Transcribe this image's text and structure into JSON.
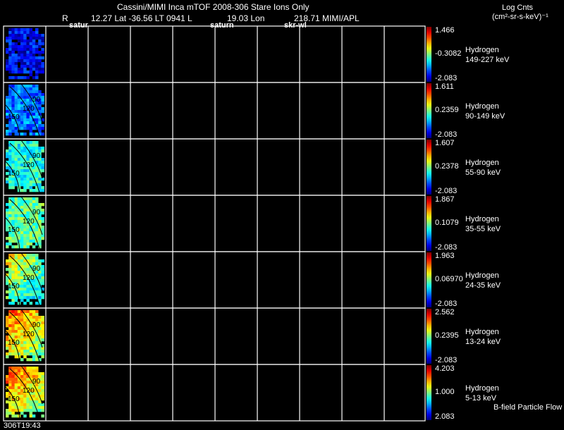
{
  "header": {
    "title": "Cassini/MIMI Inca mTOF  2008-306   Stare   Ions Only",
    "r_label": "R",
    "r_line": "12.27 Lat -36.56 LT 0941 L",
    "l_value": "19.03 Lon",
    "lon_value": "218.71  MIMI/APL",
    "marker_satur": "satur",
    "marker_saturn": "saturn",
    "marker_skr": "skr-wl"
  },
  "units": {
    "line1": "Log Cnts",
    "line2": "(cm²-sr-s-keV)⁻¹"
  },
  "footer": {
    "timestamp": "306T19:43",
    "legend_note": "B-field Particle Flow"
  },
  "contour_labels": [
    "90",
    "120",
    "150"
  ],
  "panels": [
    {
      "species": "Hydrogen",
      "energy": "149-227 keV",
      "max": "1.466",
      "mid": "-0.3082",
      "min": "-2.083",
      "level": 0.12
    },
    {
      "species": "Hydrogen",
      "energy": "90-149 keV",
      "max": "1.611",
      "mid": "0.2359",
      "min": "-2.083",
      "level": 0.24
    },
    {
      "species": "Hydrogen",
      "energy": "55-90 keV",
      "max": "1.607",
      "mid": "0.2378",
      "min": "-2.083",
      "level": 0.4
    },
    {
      "species": "Hydrogen",
      "energy": "35-55 keV",
      "max": "1.867",
      "mid": "0.1079",
      "min": "-2.083",
      "level": 0.46
    },
    {
      "species": "Hydrogen",
      "energy": "24-35 keV",
      "max": "1.963",
      "mid": "0.06970",
      "min": "-2.083",
      "level": 0.56
    },
    {
      "species": "Hydrogen",
      "energy": "13-24 keV",
      "max": "2.562",
      "mid": "0.2395",
      "min": "-2.083",
      "level": 0.7
    },
    {
      "species": "Hydrogen",
      "energy": "5-13 keV",
      "max": "4.203",
      "mid": "1.000",
      "min": "2.083",
      "level": 0.72
    }
  ]
}
